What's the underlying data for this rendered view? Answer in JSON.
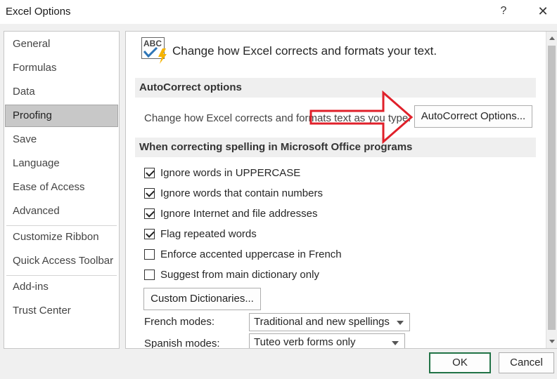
{
  "window": {
    "title": "Excel Options",
    "help_label": "?",
    "close_label": "✕"
  },
  "sidebar": {
    "items": [
      {
        "label": "General"
      },
      {
        "label": "Formulas"
      },
      {
        "label": "Data"
      },
      {
        "label": "Proofing",
        "selected": true
      },
      {
        "label": "Save"
      },
      {
        "label": "Language"
      },
      {
        "label": "Ease of Access"
      },
      {
        "label": "Advanced"
      },
      {
        "label": "Customize Ribbon"
      },
      {
        "label": "Quick Access Toolbar"
      },
      {
        "label": "Add-ins"
      },
      {
        "label": "Trust Center"
      }
    ]
  },
  "content": {
    "header_icon_text": "ABC",
    "header": "Change how Excel corrects and formats your text.",
    "autocorrect": {
      "section_title": "AutoCorrect options",
      "description": "Change how Excel corrects and formats text as you type:",
      "button_label": "AutoCorrect Options..."
    },
    "spelling": {
      "section_title": "When correcting spelling in Microsoft Office programs",
      "options": [
        {
          "label": "Ignore words in UPPERCASE",
          "checked": true
        },
        {
          "label": "Ignore words that contain numbers",
          "checked": true
        },
        {
          "label": "Ignore Internet and file addresses",
          "checked": true
        },
        {
          "label": "Flag repeated words",
          "checked": true
        },
        {
          "label": "Enforce accented uppercase in French",
          "checked": false
        },
        {
          "label": "Suggest from main dictionary only",
          "checked": false
        }
      ],
      "custom_dictionaries_label": "Custom Dictionaries...",
      "french_modes_label": "French modes:",
      "french_modes_value": "Traditional and new spellings",
      "spanish_modes_label": "Spanish modes:",
      "spanish_modes_value": "Tuteo verb forms only"
    }
  },
  "footer": {
    "ok_label": "OK",
    "cancel_label": "Cancel"
  },
  "colors": {
    "accent_green": "#217346",
    "annotation_red": "#e0202a"
  }
}
